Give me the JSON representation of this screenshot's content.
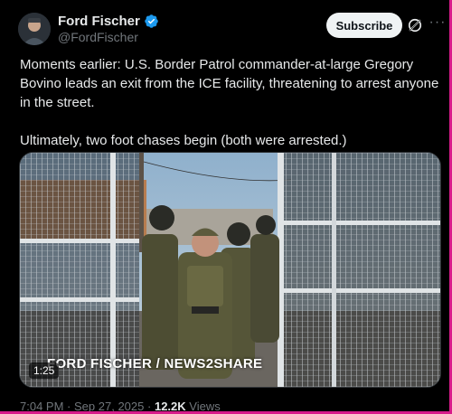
{
  "header": {
    "display_name": "Ford Fischer",
    "handle": "@FordFischer",
    "subscribe_label": "Subscribe",
    "grok_icon": "grok-icon",
    "more_icon": "more-icon",
    "more_glyph": "···",
    "verified_icon": "verified-badge-icon",
    "verified_color": "#1d9bf0"
  },
  "tweet": {
    "paragraph1": "Moments earlier: U.S. Border Patrol commander-at-large Gregory Bovino leads an exit from the ICE facility, threatening to arrest anyone in the street.",
    "paragraph2": "Ultimately, two foot chases begin (both were arrested.)"
  },
  "media": {
    "watermark": "FORD FISCHER / NEWS2SHARE",
    "duration": "1:25"
  },
  "meta": {
    "time": "7:04 PM",
    "separator": "·",
    "date": "Sep 27, 2025",
    "views_count": "12.2K",
    "views_label": "Views"
  },
  "colors": {
    "background": "#000000",
    "text_primary": "#e7e9ea",
    "text_secondary": "#71767b",
    "accent_border": "#d81b8a"
  }
}
